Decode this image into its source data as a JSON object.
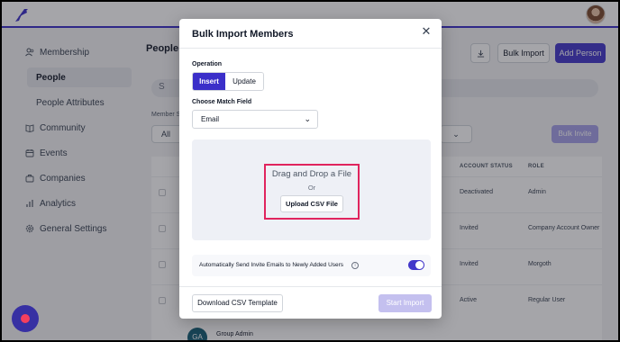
{
  "sidebar": {
    "membership": "Membership",
    "people": "People",
    "people_attributes": "People Attributes",
    "community": "Community",
    "events": "Events",
    "companies": "Companies",
    "analytics": "Analytics",
    "general_settings": "General Settings"
  },
  "main": {
    "title": "People",
    "bulk_import": "Bulk Import",
    "add_person": "Add Person",
    "search_placeholder": "S",
    "member_label": "Member S",
    "all_filter": "All",
    "bulk_invite": "Bulk Invite",
    "columns": {
      "account_status": "ACCOUNT STATUS",
      "role": "ROLE"
    },
    "rows": [
      {
        "status": "Deactivated",
        "role": "Admin"
      },
      {
        "status": "Invited",
        "role": "Company Account Owner"
      },
      {
        "status": "Invited",
        "role": "Morgoth"
      },
      {
        "status": "Active",
        "role": "Regular User"
      }
    ],
    "group_admin": "Group Admin",
    "group_admin_initials": "GA"
  },
  "modal": {
    "title": "Bulk Import Members",
    "close_glyph": "✕",
    "operation_label": "Operation",
    "insert": "Insert",
    "update": "Update",
    "match_label": "Choose Match Field",
    "match_value": "Email",
    "chevron_glyph": "⌄",
    "dropzone_title": "Drag and Drop a File",
    "dropzone_or": "Or",
    "upload_button": "Upload CSV File",
    "auto_send_label": "Automatically Send Invite Emails to Newly Added Users",
    "info_glyph": "i",
    "auto_send_enabled": true,
    "download_template": "Download CSV Template",
    "start_import": "Start Import"
  },
  "colors": {
    "accent": "#3b2fc9",
    "highlight_border": "#e0245e"
  }
}
